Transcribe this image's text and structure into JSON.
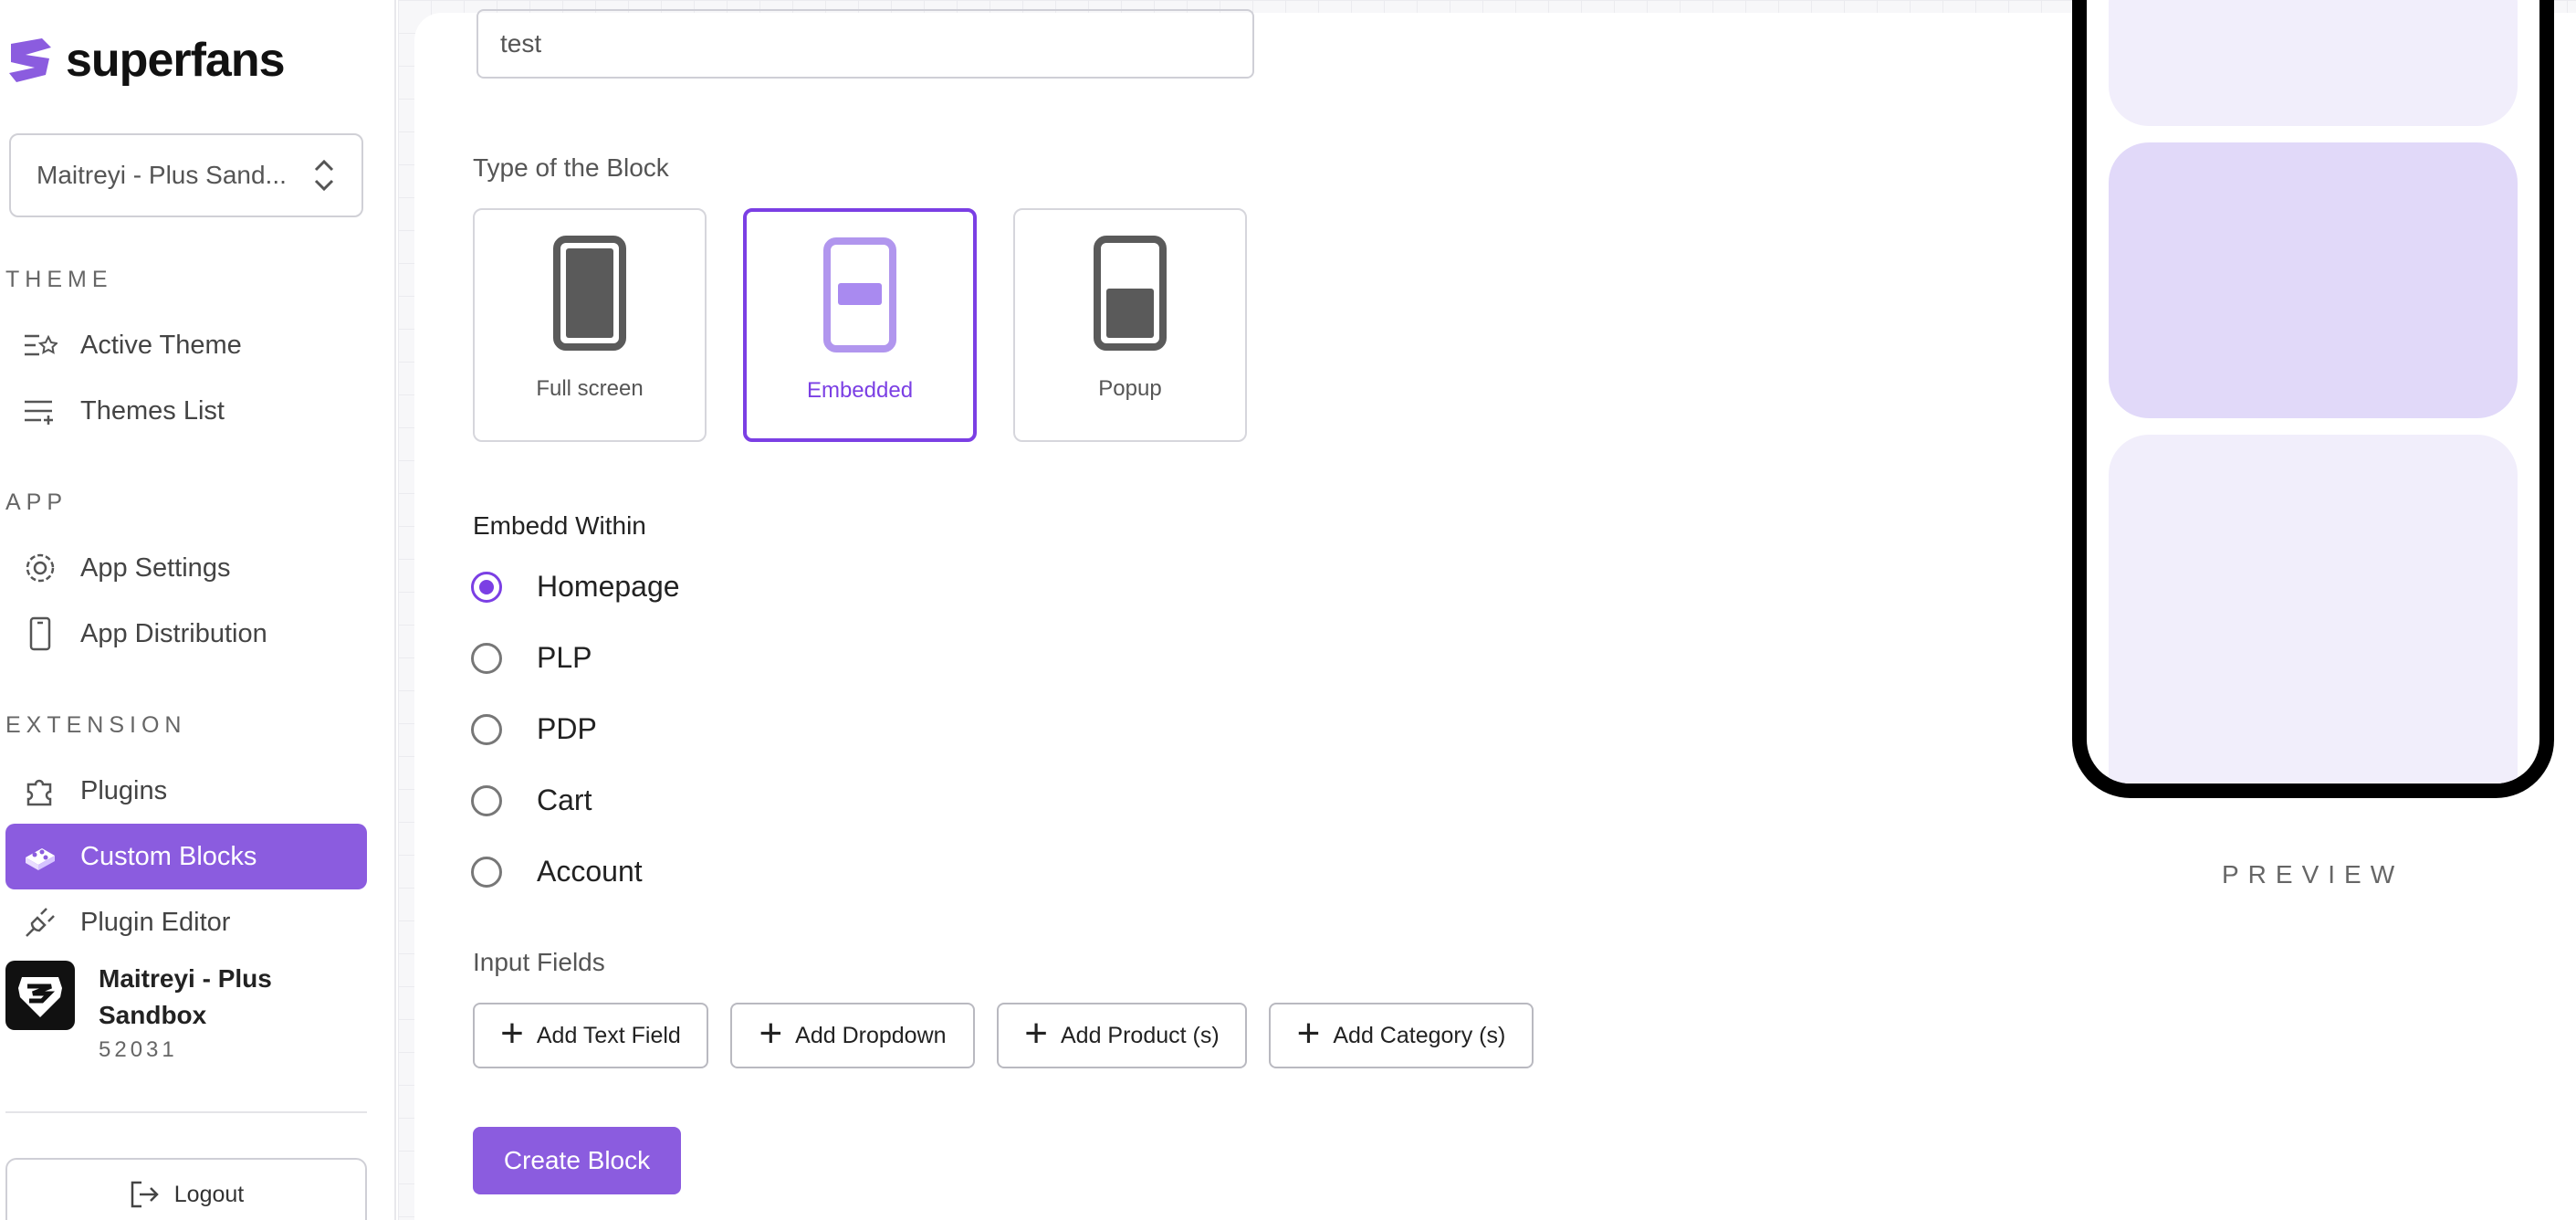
{
  "brand": {
    "name": "superfans",
    "accent": "#8b5cdf"
  },
  "store_select": {
    "value": "Maitreyi - Plus Sand..."
  },
  "sidebar": {
    "sections": [
      {
        "title": "THEME",
        "items": [
          {
            "label": "Active Theme",
            "icon": "list-star-icon"
          },
          {
            "label": "Themes List",
            "icon": "list-plus-icon"
          }
        ]
      },
      {
        "title": "APP",
        "items": [
          {
            "label": "App Settings",
            "icon": "gear-icon"
          },
          {
            "label": "App Distribution",
            "icon": "phone-icon"
          }
        ]
      },
      {
        "title": "EXTENSION",
        "items": [
          {
            "label": "Plugins",
            "icon": "puzzle-icon"
          },
          {
            "label": "Custom Blocks",
            "icon": "blocks-icon",
            "active": true
          },
          {
            "label": "Plugin Editor",
            "icon": "plug-icon"
          }
        ]
      }
    ],
    "account": {
      "name": "Maitreyi - Plus Sandbox",
      "id": "52031"
    },
    "logout_label": "Logout"
  },
  "form": {
    "name_value": "test",
    "type_label": "Type of the Block",
    "types": [
      {
        "label": "Full screen"
      },
      {
        "label": "Embedded",
        "selected": true
      },
      {
        "label": "Popup"
      }
    ],
    "embed_label": "Embedd Within",
    "embed_options": [
      {
        "label": "Homepage",
        "checked": true
      },
      {
        "label": "PLP"
      },
      {
        "label": "PDP"
      },
      {
        "label": "Cart"
      },
      {
        "label": "Account"
      }
    ],
    "input_fields_label": "Input Fields",
    "add_buttons": [
      {
        "label": "Add Text Field"
      },
      {
        "label": "Add Dropdown"
      },
      {
        "label": "Add Product (s)"
      },
      {
        "label": "Add Category (s)"
      }
    ],
    "create_label": "Create Block"
  },
  "preview": {
    "label": "PREVIEW"
  }
}
